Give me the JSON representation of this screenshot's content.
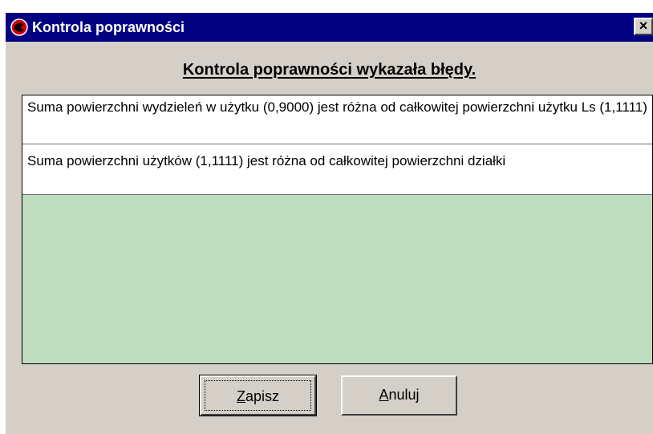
{
  "window": {
    "title": "Kontrola poprawności",
    "close_label": "×"
  },
  "dialog": {
    "heading": "Kontrola poprawności wykazała błędy."
  },
  "errors": [
    "Suma powierzchni wydzieleń w użytku (0,9000) jest różna od całkowitej powierzchni użytku Ls (1,1111)",
    "Suma powierzchni użytków (1,1111) jest różna od całkowitej powierzchni działki"
  ],
  "buttons": {
    "save": {
      "mnemonic": "Z",
      "rest": "apisz"
    },
    "cancel": {
      "mnemonic": "A",
      "rest": "nuluj"
    }
  },
  "colors": {
    "titlebar": "#000080",
    "list_background": "#bddcc0",
    "dialog_face": "#d4d0c8"
  }
}
